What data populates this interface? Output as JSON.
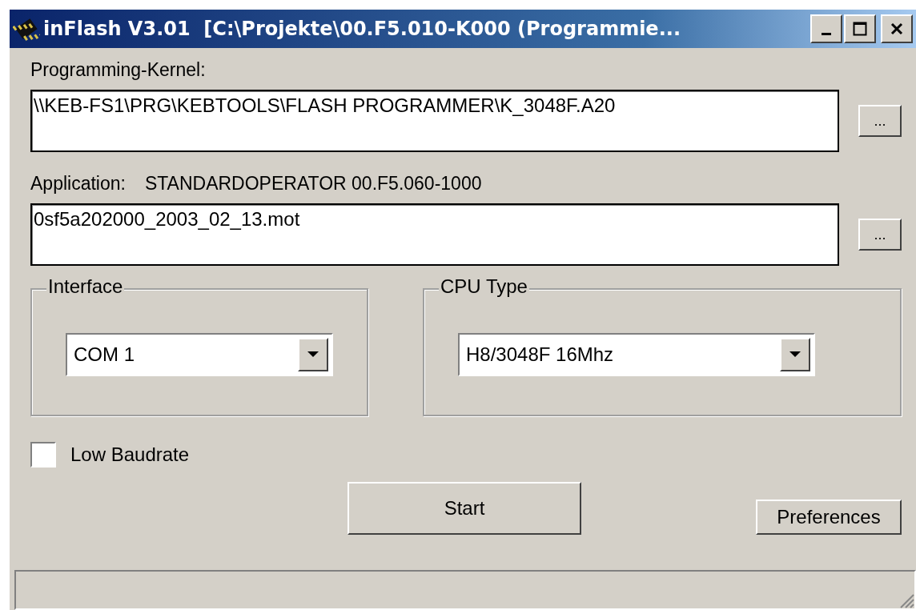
{
  "window": {
    "title": "inFlash V3.01  [C:\\Projekte\\00.F5.010-K000 (Programmie..."
  },
  "kernel": {
    "label": "Programming-Kernel:",
    "value": "\\\\KEB-FS1\\PRG\\KEBTOOLS\\FLASH PROGRAMMER\\K_3048F.A20",
    "browse": "..."
  },
  "application": {
    "label": "Application:",
    "name": "STANDARDOPERATOR 00.F5.060-1000",
    "value": "0sf5a202000_2003_02_13.mot",
    "browse": "..."
  },
  "groups": [
    {
      "title": "Interface",
      "value": "COM 1"
    },
    {
      "title": "CPU Type",
      "value": "H8/3048F 16Mhz"
    }
  ],
  "low_baudrate": {
    "label": "Low Baudrate",
    "checked": false
  },
  "buttons": {
    "start": "Start",
    "preferences": "Preferences"
  }
}
